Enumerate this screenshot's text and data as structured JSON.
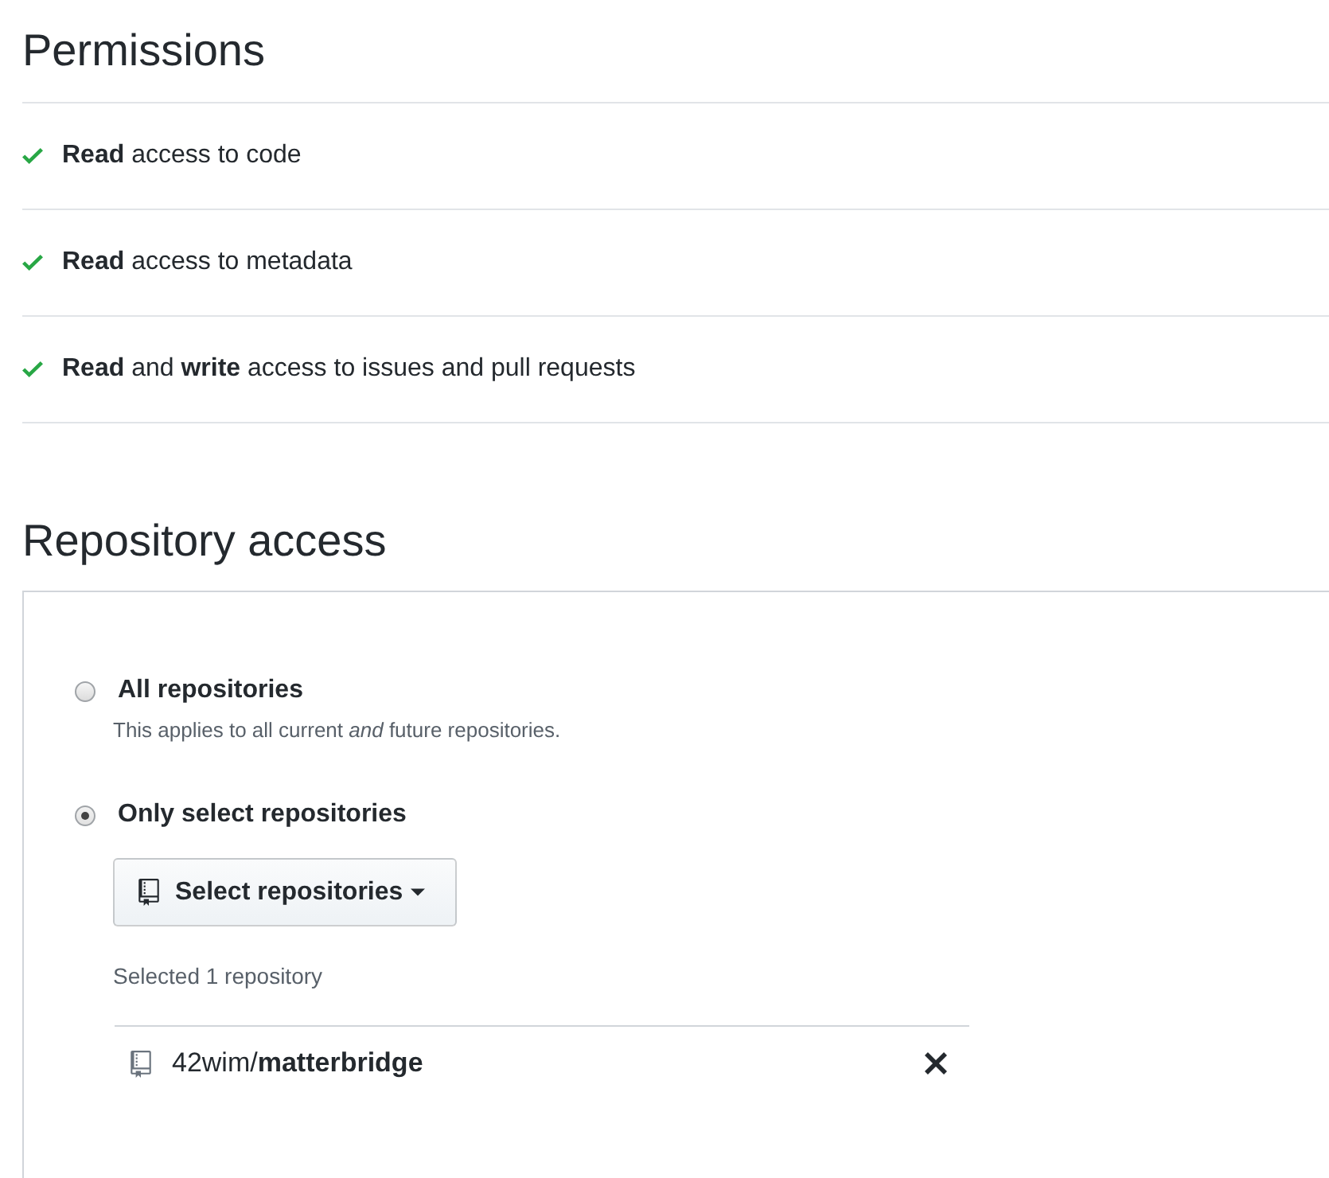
{
  "permissions": {
    "title": "Permissions",
    "items": [
      {
        "text": "**Read** access to code"
      },
      {
        "text": "**Read** access to metadata"
      },
      {
        "text": "**Read** and **write** access to issues and pull requests"
      }
    ]
  },
  "repository_access": {
    "title": "Repository access",
    "options": [
      {
        "label": "All repositories",
        "description": "This applies to all current *and* future repositories.",
        "selected": false
      },
      {
        "label": "Only select repositories",
        "selected": true
      }
    ],
    "select_button": {
      "label": "Select repositories"
    },
    "selected_count": "Selected 1 repository",
    "repositories": [
      {
        "name": "42wim/**matterbridge**"
      }
    ]
  }
}
